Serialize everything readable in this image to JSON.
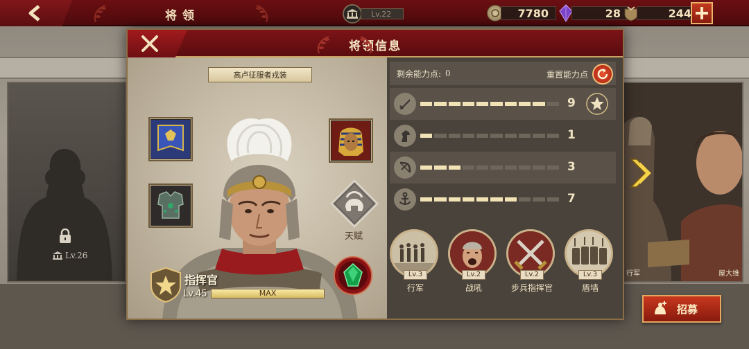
{
  "topbar": {
    "title": "将领",
    "city_level": "Lv.22",
    "resources": [
      {
        "name": "coin",
        "icon": "coin-icon",
        "value": "7780"
      },
      {
        "name": "gem",
        "icon": "purple-gem-icon",
        "value": "28"
      },
      {
        "name": "medal",
        "icon": "helmet-badge-icon",
        "value": "244"
      }
    ],
    "plus_label": "+"
  },
  "background": {
    "locked_hero_level": "Lv.26",
    "right_hero_name_1": "行军",
    "right_hero_name_2": "屋大维"
  },
  "modal": {
    "title": "将领信息",
    "skin_name": "高卢征服者戎装",
    "talent_label": "天赋",
    "hero": {
      "name": "指挥官",
      "level": "Lv.45",
      "xp_label": "MAX",
      "xp_progress": 1.0
    },
    "points": {
      "label": "剩余能力点:",
      "value": "0",
      "reset_label": "重置能力点"
    },
    "stats": [
      {
        "icon": "sword-icon",
        "value": "9",
        "filled": 9
      },
      {
        "icon": "horse-icon",
        "value": "1",
        "filled": 1
      },
      {
        "icon": "bow-icon",
        "value": "3",
        "filled": 3
      },
      {
        "icon": "anchor-icon",
        "value": "7",
        "filled": 7
      }
    ],
    "skills": [
      {
        "icon": "march-icon",
        "level": "Lv.3",
        "name": "行军"
      },
      {
        "icon": "war-cry-icon",
        "level": "Lv.2",
        "name": "战吼"
      },
      {
        "icon": "crossed-swords-icon",
        "level": "Lv.2",
        "name": "步兵指挥官"
      },
      {
        "icon": "shield-wall-icon",
        "level": "Lv.3",
        "name": "盾墙"
      }
    ]
  },
  "recruit": {
    "label": "招募"
  },
  "colors": {
    "accent_red": "#7c1317",
    "gold": "#c9a060",
    "stat_fill": "#f1e3b5"
  }
}
